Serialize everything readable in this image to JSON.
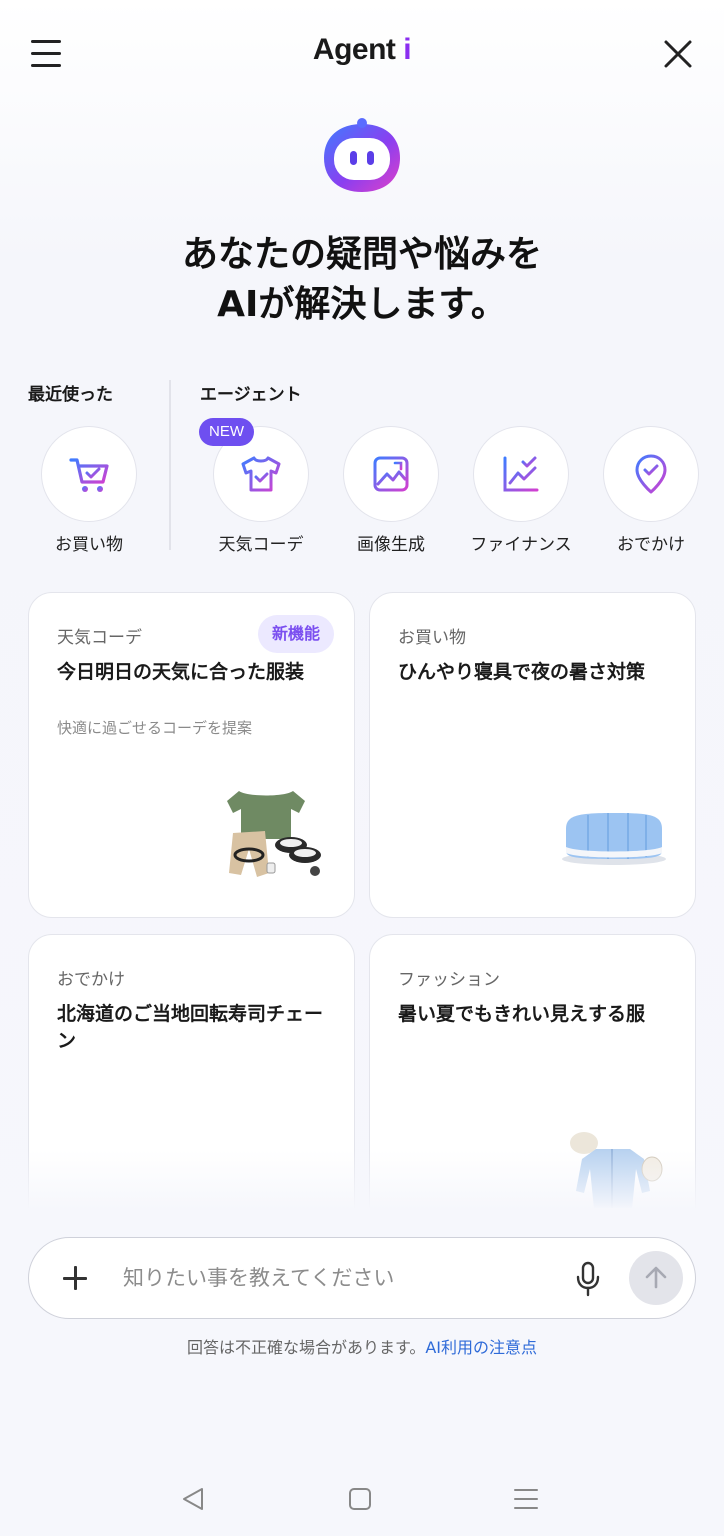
{
  "header": {
    "title_main": "Agent",
    "title_accent": "i"
  },
  "hero": {
    "line1": "あなたの疑問や悩みを",
    "line2": "AIが解決します。"
  },
  "recent": {
    "label": "最近使った",
    "items": [
      {
        "label": "お買い物",
        "icon": "shopping-cart-icon"
      }
    ]
  },
  "agents": {
    "label": "エージェント",
    "new_badge": "NEW",
    "items": [
      {
        "label": "天気コーデ",
        "icon": "tshirt-icon"
      },
      {
        "label": "画像生成",
        "icon": "image-icon"
      },
      {
        "label": "ファイナンス",
        "icon": "chart-icon"
      },
      {
        "label": "おでかけ",
        "icon": "location-pin-icon"
      }
    ]
  },
  "cards": [
    {
      "category": "天気コーデ",
      "badge": "新機能",
      "title": "今日明日の天気に合った服装",
      "subtitle": "快適に過ごせるコーデを提案",
      "image": "outfit-illustration"
    },
    {
      "category": "お買い物",
      "title": "ひんやり寝具で夜の暑さ対策",
      "image": "pillow-illustration"
    },
    {
      "category": "おでかけ",
      "title": "北海道のご当地回転寿司チェーン",
      "image": "sushi-illustration"
    },
    {
      "category": "ファッション",
      "title": "暑い夏でもきれい見えする服",
      "image": "summer-outfit-illustration"
    }
  ],
  "chat": {
    "placeholder": "知りたい事を教えてください"
  },
  "disclaimer": {
    "text": "回答は不正確な場合があります。",
    "link": "AI利用の注意点"
  },
  "colors": {
    "accent_purple": "#8b2ef0",
    "badge_purple": "#6e4ff0",
    "link_blue": "#2f6bd8"
  }
}
